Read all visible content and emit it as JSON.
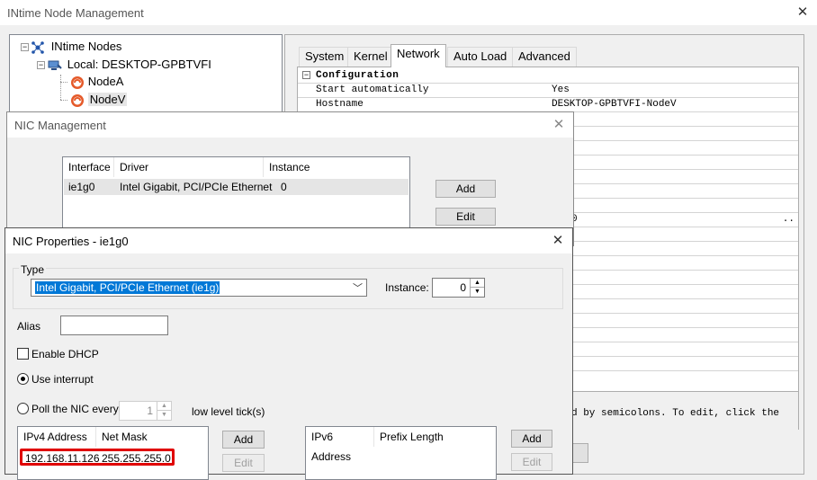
{
  "main": {
    "title": "INtime Node Management",
    "tree": {
      "root": "INtime Nodes",
      "local": "Local: DESKTOP-GPBTVFI",
      "nodes": [
        "NodeA",
        "NodeV"
      ]
    },
    "tabs": [
      "System",
      "Kernel",
      "Network",
      "Auto Load",
      "Advanced"
    ],
    "grid": {
      "section": "Configuration",
      "rows": [
        {
          "key": "Start automatically",
          "value": "Yes"
        },
        {
          "key": "Hostname",
          "value": "DESKTOP-GPBTVFI-NodeV"
        }
      ],
      "partial_value": "0",
      "ellipsis": "..",
      "description": "d by semicolons. To edit, click the"
    }
  },
  "nic_mgmt": {
    "title": "NIC Management",
    "headers": [
      "Interface",
      "Driver",
      "Instance"
    ],
    "rows": [
      {
        "iface": "ie1g0",
        "driver": "Intel Gigabit, PCI/PCIe Ethernet",
        "instance": "0"
      }
    ],
    "add_label": "Add",
    "edit_label": "Edit"
  },
  "nic_props": {
    "title": "NIC Properties - ie1g0",
    "type_label": "Type",
    "type_value": "Intel Gigabit, PCI/PCIe Ethernet (ie1g)",
    "instance_label": "Instance:",
    "instance_value": "0",
    "alias_label": "Alias",
    "alias_value": "",
    "dhcp_label": "Enable DHCP",
    "use_interrupt_label": "Use interrupt",
    "poll_label": "Poll the NIC every",
    "poll_value": "1",
    "poll_unit": "low level tick(s)",
    "ipv4": {
      "headers": [
        "IPv4 Address",
        "Net Mask"
      ],
      "rows": [
        {
          "address": "192.168.11.126",
          "mask": "255.255.255.0"
        }
      ],
      "add_label": "Add",
      "edit_label": "Edit"
    },
    "ipv6": {
      "headers": [
        "IPv6 Address",
        "Prefix Length"
      ],
      "add_label": "Add",
      "edit_label": "Edit"
    },
    "highlight_color": "#e00000"
  }
}
